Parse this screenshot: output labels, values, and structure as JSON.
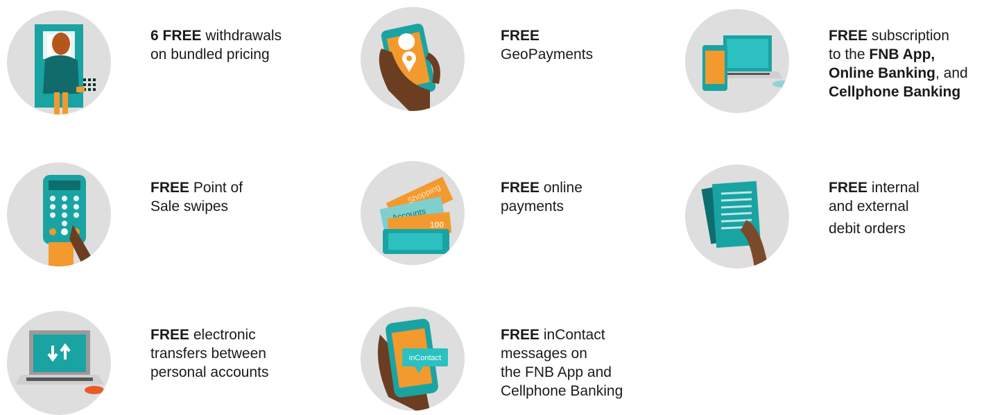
{
  "features": [
    {
      "icon": "atm-withdrawal-icon",
      "bold": "6 FREE",
      "lines": [
        " withdrawals",
        "on bundled pricing"
      ]
    },
    {
      "icon": "geopayments-phone-icon",
      "bold": "FREE",
      "lines": [
        "",
        "GeoPayments"
      ]
    },
    {
      "icon": "devices-app-icon",
      "bold": "FREE",
      "lines": [
        " subscription",
        "to the ",
        "FNB App,",
        "Online Banking",
        ", and",
        "Cellphone Banking"
      ]
    },
    {
      "icon": "pos-terminal-icon",
      "bold": "FREE",
      "lines": [
        " Point of",
        "Sale swipes"
      ]
    },
    {
      "icon": "online-payments-wallet-icon",
      "bold": "FREE",
      "lines": [
        " online",
        "payments"
      ]
    },
    {
      "icon": "debit-order-documents-icon",
      "bold": "FREE",
      "lines": [
        " internal",
        "and external",
        "debit orders"
      ]
    },
    {
      "icon": "laptop-transfer-icon",
      "bold": "FREE",
      "lines": [
        " electronic",
        "transfers between",
        "personal accounts"
      ]
    },
    {
      "icon": "incontact-phone-icon",
      "bold": "FREE",
      "lines": [
        " inContact",
        "messages on",
        "the FNB App and",
        "Cellphone Banking"
      ]
    }
  ],
  "illustration_labels": {
    "incontact_bubble": "inContact",
    "card_labels": [
      "Shopping",
      "Accounts",
      "100"
    ]
  },
  "colors": {
    "circle": "#dedede",
    "teal": "#1aa3a3",
    "orange": "#f29a2e",
    "skin": "#7a4a2a"
  }
}
